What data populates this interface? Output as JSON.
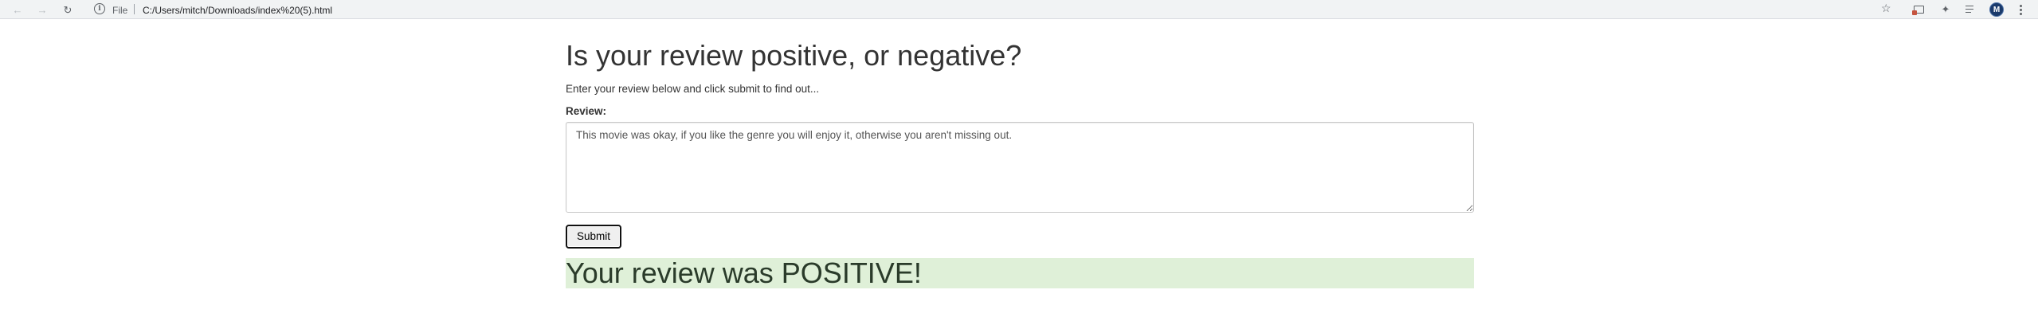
{
  "browser": {
    "url_scheme_label": "File",
    "url": "C:/Users/mitch/Downloads/index%20(5).html",
    "avatar_initial": "M"
  },
  "page": {
    "title": "Is your review positive, or negative?",
    "subtitle": "Enter your review below and click submit to find out...",
    "review_label": "Review:",
    "review_value": "This movie was okay, if you like the genre you will enjoy it, otherwise you aren't missing out.",
    "submit_label": "Submit",
    "result_text": "Your review was POSITIVE!"
  },
  "colors": {
    "result_background": "#dff0d8",
    "toolbar_background": "#f1f3f4",
    "text": "#333333"
  }
}
